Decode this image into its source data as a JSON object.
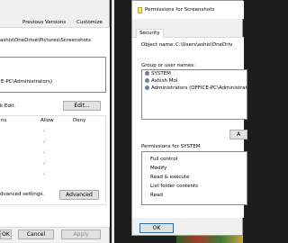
{
  "left_dialog": {
    "tabs": [
      "Previous Versions",
      "Customize"
    ],
    "object_path": "ashis\\OneDrive\\Pictures\\Screenshots",
    "group_user_partial": "E-PC\\Administrators)",
    "edit_hint": "k Edit.",
    "edit_button": "Edit...",
    "perm_columns": {
      "name": "ns",
      "allow": "Allow",
      "deny": "Deny"
    },
    "advanced_hint": "dvanced settings.",
    "advanced_button": "Advanced",
    "ok": "OK",
    "cancel": "Cancel",
    "apply": "Apply"
  },
  "right_dialog": {
    "title": "Permissions for Screenshots",
    "tab_security": "Security",
    "object_name_label": "Object name:",
    "object_name_value": "C:\\Users\\ashis\\OneDriv",
    "group_label": "Group or user names:",
    "users": [
      "SYSTEM",
      "Ashish Mol",
      "Administrators (OFFICE-PC\\Administrat"
    ],
    "add_partial": "A",
    "perms_for": "Permissions for SYSTEM",
    "permissions": [
      "Full control",
      "Modify",
      "Read & execute",
      "List folder contents",
      "Read"
    ],
    "ok": "OK"
  }
}
